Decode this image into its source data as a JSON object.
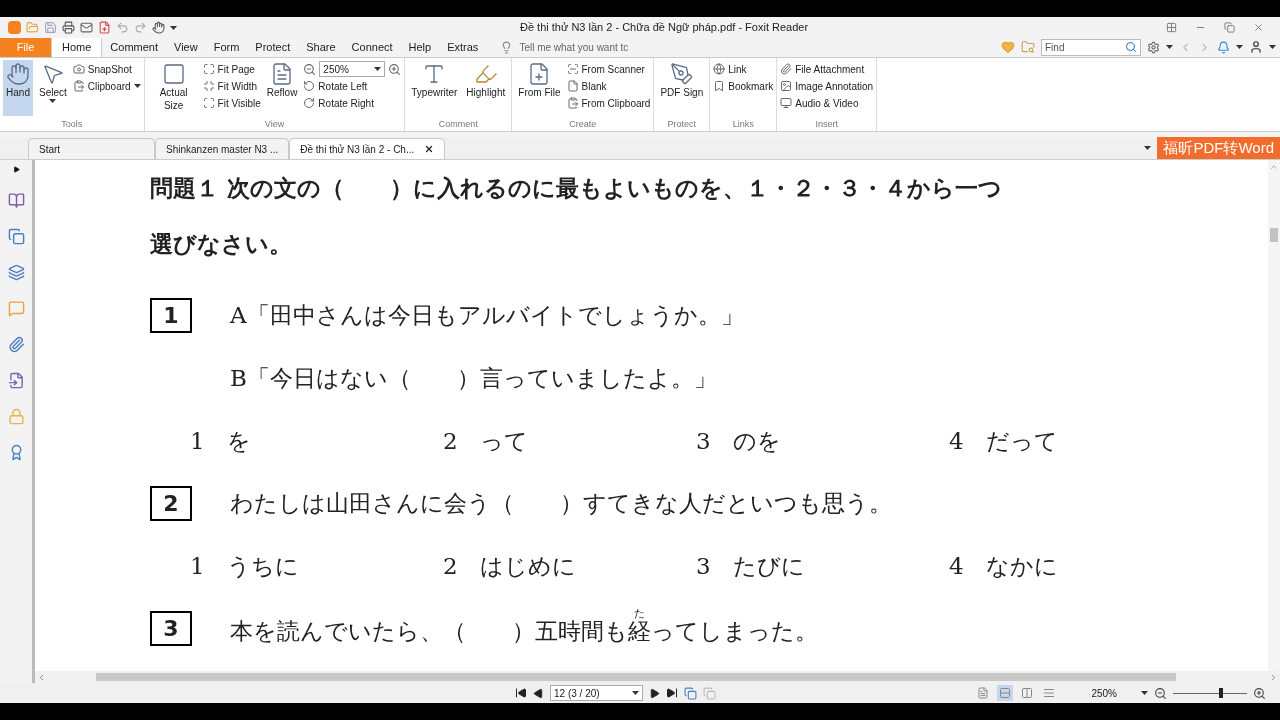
{
  "window": {
    "title": "Đề thi thử N3 lần 2 - Chữa đề Ngữ pháp.pdf - Foxit Reader"
  },
  "menu_tabs": [
    {
      "label": "File",
      "kind": "file",
      "selected": false
    },
    {
      "label": "Home",
      "kind": "tab",
      "selected": true
    },
    {
      "label": "Comment",
      "kind": "tab",
      "selected": false
    },
    {
      "label": "View",
      "kind": "tab",
      "selected": false
    },
    {
      "label": "Form",
      "kind": "tab",
      "selected": false
    },
    {
      "label": "Protect",
      "kind": "tab",
      "selected": false
    },
    {
      "label": "Share",
      "kind": "tab",
      "selected": false
    },
    {
      "label": "Connect",
      "kind": "tab",
      "selected": false
    },
    {
      "label": "Help",
      "kind": "tab",
      "selected": false
    },
    {
      "label": "Extras",
      "kind": "tab",
      "selected": false
    }
  ],
  "tell_me": {
    "placeholder": "Tell me what you want tc"
  },
  "find": {
    "placeholder": "Find"
  },
  "ribbon": [
    {
      "label": "Tools",
      "columns": [
        {
          "kind": "large",
          "label": "Hand",
          "selected": true
        },
        {
          "kind": "large",
          "label": "Select",
          "selected": false,
          "caret": true
        },
        {
          "kind": "stack",
          "items": [
            {
              "label": "SnapShot"
            },
            {
              "label": "Clipboard",
              "caret": true
            }
          ]
        }
      ]
    },
    {
      "label": "View",
      "columns": [
        {
          "kind": "large",
          "label": "Actual Size",
          "selected": false
        },
        {
          "kind": "stack",
          "items": [
            {
              "label": "Fit Page"
            },
            {
              "label": "Fit Width"
            },
            {
              "label": "Fit Visible"
            }
          ]
        },
        {
          "kind": "large",
          "label": "Reflow",
          "selected": false
        },
        {
          "kind": "stack",
          "items": [
            {
              "kind": "combo",
              "value": "250%"
            },
            {
              "label": "Rotate Left"
            },
            {
              "label": "Rotate Right"
            }
          ]
        }
      ]
    },
    {
      "label": "Comment",
      "columns": [
        {
          "kind": "large",
          "label": "Typewriter",
          "selected": false
        },
        {
          "kind": "large",
          "label": "Highlight",
          "selected": false
        }
      ]
    },
    {
      "label": "Create",
      "columns": [
        {
          "kind": "large",
          "label": "From File",
          "selected": false
        },
        {
          "kind": "stack",
          "items": [
            {
              "label": "From Scanner"
            },
            {
              "label": "Blank"
            },
            {
              "label": "From Clipboard"
            }
          ]
        }
      ]
    },
    {
      "label": "Protect",
      "columns": [
        {
          "kind": "large",
          "label": "PDF Sign",
          "selected": false
        }
      ]
    },
    {
      "label": "Links",
      "columns": [
        {
          "kind": "stack",
          "items": [
            {
              "label": "Link"
            },
            {
              "label": "Bookmark"
            }
          ]
        }
      ]
    },
    {
      "label": "Insert",
      "columns": [
        {
          "kind": "stack",
          "items": [
            {
              "label": "File Attachment"
            },
            {
              "label": "Image Annotation"
            },
            {
              "label": "Audio & Video"
            }
          ]
        }
      ]
    }
  ],
  "doc_tabs": [
    {
      "label": "Start",
      "selected": false,
      "closable": false
    },
    {
      "label": "Shinkanzen master N3 ...",
      "selected": false,
      "closable": false
    },
    {
      "label": "Đề thi thử N3 lần 2 - Ch...",
      "selected": true,
      "closable": true
    }
  ],
  "promo_button": "福昕PDF转Word",
  "document": {
    "instruction": [
      "問題１ 次の文の（　　）に入れるのに最もよいものを、１・２・３・４から一つ",
      "選びなさい。"
    ],
    "questions": [
      {
        "number": "1",
        "lines": [
          [
            {
              "text": "A「田中さんは今日もアルバイトでしょうか。」"
            }
          ],
          [
            {
              "text": "B「今日はない（　　）言っていましたよ。」"
            }
          ]
        ],
        "options": [
          {
            "number": "1",
            "text": "を"
          },
          {
            "number": "2",
            "text": "って"
          },
          {
            "number": "3",
            "text": "のを"
          },
          {
            "number": "4",
            "text": "だって"
          }
        ]
      },
      {
        "number": "2",
        "lines": [
          [
            {
              "text": "わたしは山田さんに会う（　　）すてきな人だといつも思う。"
            }
          ]
        ],
        "options": [
          {
            "number": "1",
            "text": "うちに"
          },
          {
            "number": "2",
            "text": "はじめに"
          },
          {
            "number": "3",
            "text": "たびに"
          },
          {
            "number": "4",
            "text": "なかに"
          }
        ]
      },
      {
        "number": "3",
        "lines": [
          [
            {
              "text": "本を読んでいたら、（　　）五時間も"
            },
            {
              "text": "経",
              "ruby": "た"
            },
            {
              "text": "ってしまった。"
            }
          ]
        ]
      }
    ]
  },
  "status_bar": {
    "page": "12 (3 / 20)",
    "view_modes": [
      {
        "selected": false
      },
      {
        "selected": true
      },
      {
        "selected": false
      },
      {
        "selected": false
      }
    ],
    "zoom": "250%",
    "zoom_slider": {
      "level": 0.65
    }
  }
}
